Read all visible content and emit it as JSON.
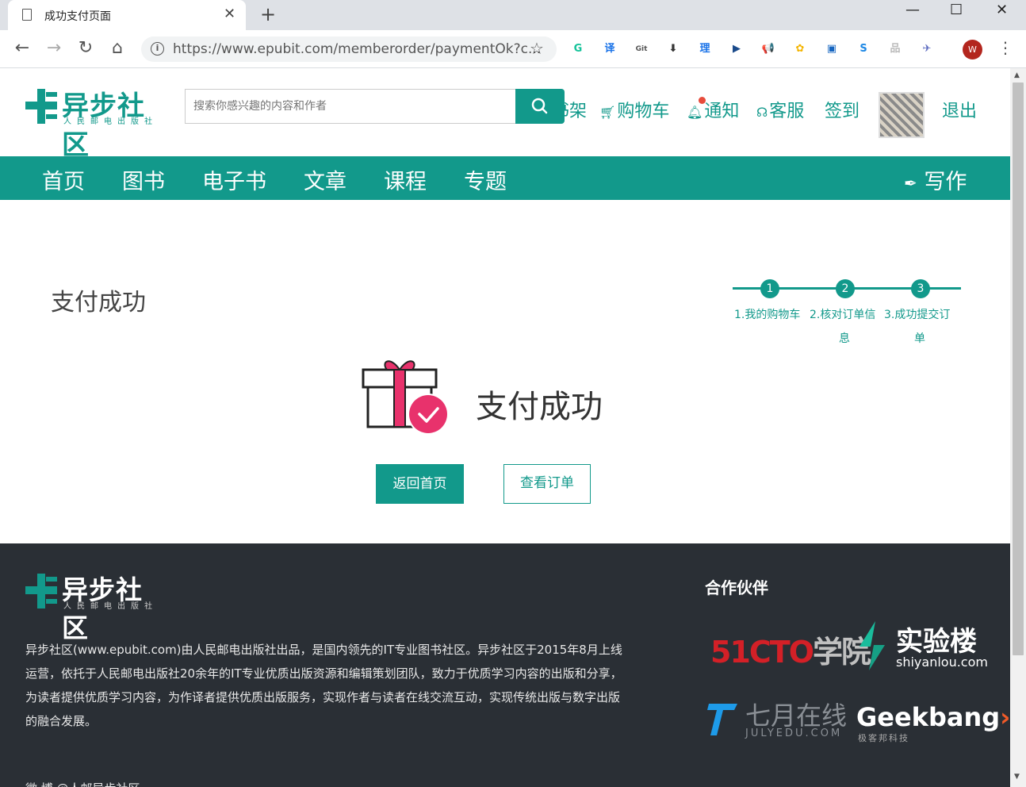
{
  "browser": {
    "tab_title": "成功支付页面",
    "url": "https://www.epubit.com/memberorder/paymentOk?c...",
    "profile_initial": "W",
    "extensions": [
      {
        "name": "grammarly-icon",
        "glyph": "G",
        "color": "#15c39a"
      },
      {
        "name": "translate-icon",
        "glyph": "译",
        "color": "#1a73e8"
      },
      {
        "name": "gitzip-icon",
        "glyph": "Git",
        "color": "#555555"
      },
      {
        "name": "download-icon",
        "glyph": "⬇",
        "color": "#333333"
      },
      {
        "name": "reader-on-icon",
        "glyph": "理",
        "color": "#1a73e8"
      },
      {
        "name": "play-icon",
        "glyph": "▶",
        "color": "#1a4a8a"
      },
      {
        "name": "megaphone-icon",
        "glyph": "📢",
        "color": "#e53935"
      },
      {
        "name": "photos-icon",
        "glyph": "✿",
        "color": "#f4b400"
      },
      {
        "name": "box-icon",
        "glyph": "▣",
        "color": "#1565c0"
      },
      {
        "name": "s-icon",
        "glyph": "S",
        "color": "#1e88e5"
      },
      {
        "name": "sitemap-icon",
        "glyph": "品",
        "color": "#bbbbbb"
      },
      {
        "name": "bird-icon",
        "glyph": "✈",
        "color": "#5c6bc0"
      }
    ]
  },
  "site": {
    "logo_text": "异步社区",
    "logo_sub": "人民邮电出版社",
    "search_placeholder": "搜索你感兴趣的内容和作者",
    "top_links": {
      "shelf": "书架",
      "cart": "购物车",
      "notify": "通知",
      "service": "客服",
      "signin": "签到",
      "logout": "退出"
    },
    "main_nav": [
      "首页",
      "图书",
      "电子书",
      "文章",
      "课程",
      "专题"
    ],
    "write": "写作"
  },
  "content": {
    "page_title": "支付成功",
    "steps": [
      {
        "num": "1",
        "label": "1.我的购物车"
      },
      {
        "num": "2",
        "label": "2.核对订单信",
        "label2": "息"
      },
      {
        "num": "3",
        "label": "3.成功提交订",
        "label2": "单"
      }
    ],
    "success_text": "支付成功",
    "btn_home": "返回首页",
    "btn_order": "查看订单"
  },
  "footer": {
    "logo_text": "异步社区",
    "logo_sub": "人民邮电出版社",
    "desc": "异步社区(www.epubit.com)由人民邮电出版社出品，是国内领先的IT专业图书社区。异步社区于2015年8月上线运营，依托于人民邮电出版社20余年的IT专业优质出版资源和编辑策划团队，致力于优质学习内容的出版和分享，为读者提供优质学习内容，为作译者提供优质出版服务，实现作者与读者在线交流互动，实现传统出版与数字出版的融合发展。",
    "partners_title": "合作伙伴",
    "partner_51cto": "51CTO",
    "partner_51cto_tail": "学院",
    "partner_shiyanlou": "实验楼",
    "partner_shiyanlou_url": "shiyanlou.com",
    "partner_july": "七月在线",
    "partner_july_url": "JULYEDU.COM",
    "partner_geek": "Geekbang",
    "partner_geek_sub": "极客邦科技",
    "bottom_text": "微  博    @人邮异步社区"
  },
  "colors": {
    "brand": "#12998b",
    "footer_bg": "#2a2f35",
    "check": "#e8326c"
  }
}
